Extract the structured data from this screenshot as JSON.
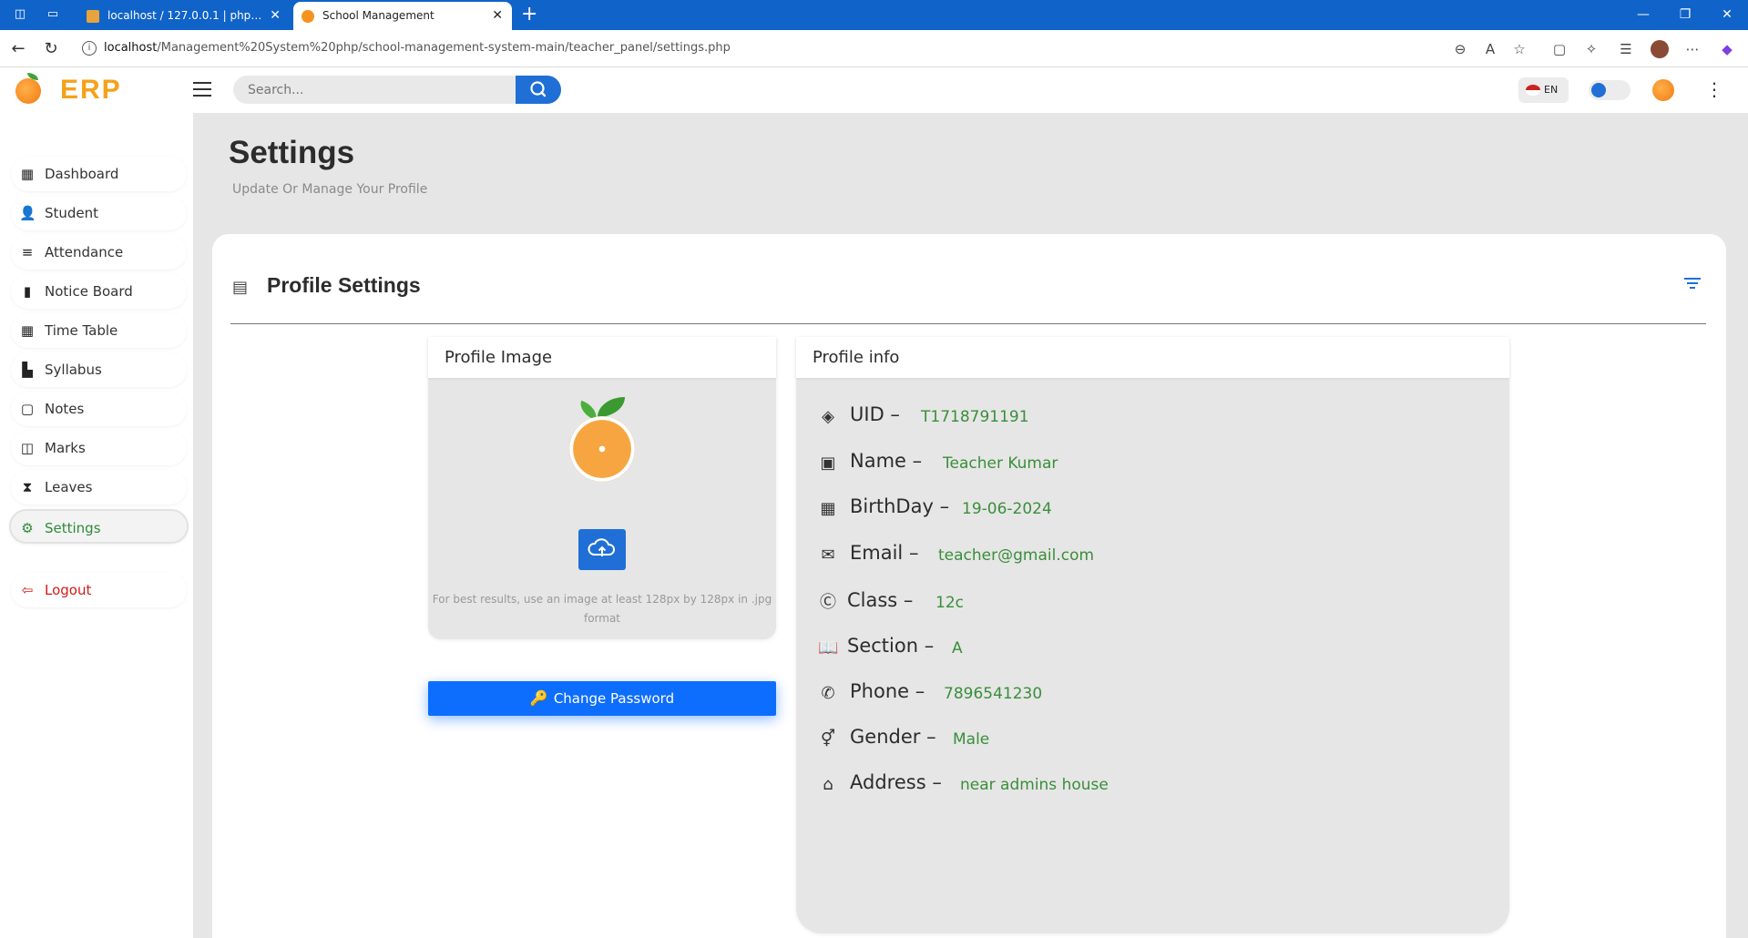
{
  "browser": {
    "tabs": [
      {
        "title": "localhost / 127.0.0.1 | phpMyAdmin",
        "active": false
      },
      {
        "title": "School Management",
        "active": true
      }
    ],
    "url_host": "localhost",
    "url_path": "/Management%20System%20php/school-management-system-main/teacher_panel/settings.php"
  },
  "header": {
    "logo_text": "ERP",
    "search_placeholder": "Search...",
    "language": "EN"
  },
  "sidebar": {
    "items": [
      {
        "label": "Dashboard",
        "icon": "dashboard-icon"
      },
      {
        "label": "Student",
        "icon": "student-icon"
      },
      {
        "label": "Attendance",
        "icon": "attendance-icon"
      },
      {
        "label": "Notice Board",
        "icon": "bookmark-icon"
      },
      {
        "label": "Time Table",
        "icon": "table-icon"
      },
      {
        "label": "Syllabus",
        "icon": "file-icon"
      },
      {
        "label": "Notes",
        "icon": "note-icon"
      },
      {
        "label": "Marks",
        "icon": "marks-icon"
      },
      {
        "label": "Leaves",
        "icon": "hourglass-icon"
      },
      {
        "label": "Settings",
        "icon": "gear-icon",
        "active": true
      }
    ],
    "logout_label": "Logout"
  },
  "page": {
    "title": "Settings",
    "subtitle": "Update Or Manage Your Profile"
  },
  "card": {
    "title": "Profile Settings",
    "profile_image_heading": "Profile Image",
    "upload_hint": "For best results, use an image at least 128px by 128px in .jpg format",
    "change_password_label": "Change Password",
    "profile_info_heading": "Profile info"
  },
  "profile": {
    "uid_label": "UID",
    "uid": "T1718791191",
    "name_label": "Name",
    "name": "Teacher Kumar",
    "birthday_label": "BirthDay",
    "birthday": "19-06-2024",
    "email_label": "Email",
    "email": "teacher@gmail.com",
    "class_label": "Class",
    "class": "12c",
    "section_label": "Section",
    "section": "A",
    "phone_label": "Phone",
    "phone": "7896541230",
    "gender_label": "Gender",
    "gender": "Male",
    "address_label": "Address",
    "address": "near admins house"
  },
  "colors": {
    "primary": "#1f6fd6",
    "active_green": "#2e8b3a",
    "logout_red": "#d11a1a",
    "value_green": "#3a8e3a",
    "logo_orange": "#f6a11b"
  }
}
